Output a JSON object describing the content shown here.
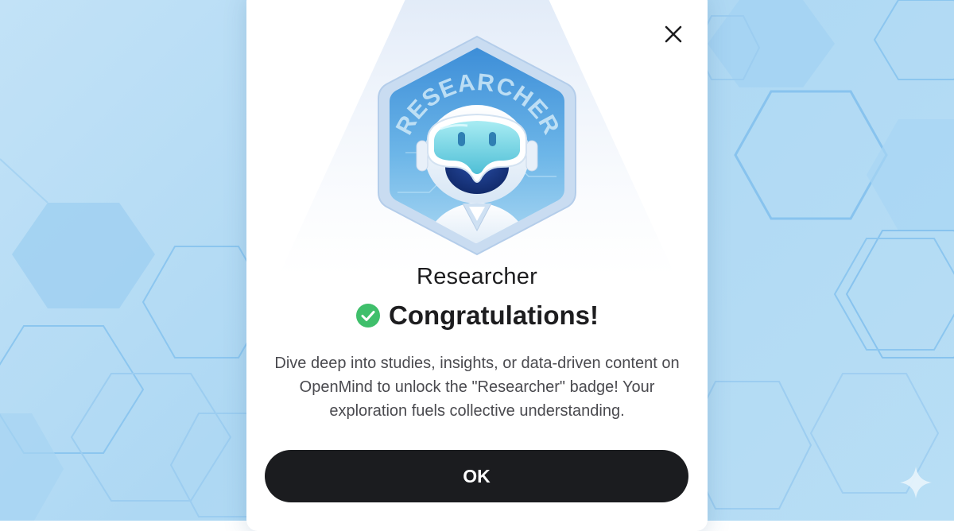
{
  "dialog": {
    "badge_name": "Researcher",
    "badge_emblem_text": "RESEARCHER",
    "congrats_text": "Congratulations!",
    "description": "Dive deep into studies, insights, or data-driven content on OpenMind to unlock the \"Researcher\" badge! Your exploration fuels collective understanding.",
    "ok_label": "OK",
    "close_icon": "close-icon",
    "check_icon": "check-circle-icon"
  },
  "colors": {
    "background": "#b4dcf5",
    "modal": "#ffffff",
    "button": "#1b1c1f",
    "check": "#3fbf6b",
    "badge_border": "#a9c8ea",
    "badge_fill": "#4d9fdc"
  }
}
